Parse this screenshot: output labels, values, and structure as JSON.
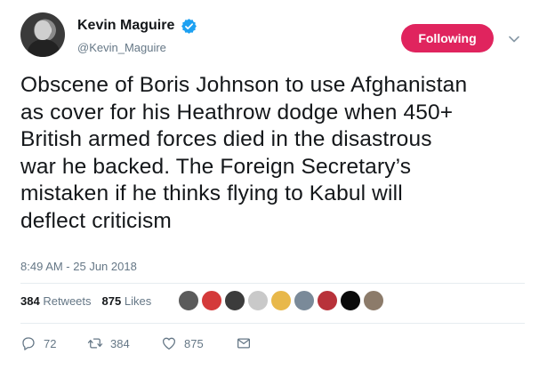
{
  "user": {
    "display_name": "Kevin Maguire",
    "handle": "@Kevin_Maguire",
    "verified_icon": "verified-badge-icon",
    "avatar_icon": "profile-avatar"
  },
  "follow_button": {
    "label": "Following",
    "color": "#e0245e"
  },
  "menu": {
    "icon": "chevron-down-icon"
  },
  "tweet": {
    "lines": [
      "Obscene of Boris Johnson to use Afghanistan",
      "as cover for his Heathrow dodge when 450+",
      "British armed forces died in the disastrous",
      "war he backed. The Foreign Secretary’s",
      "mistaken if he thinks flying to Kabul will",
      "deflect criticism"
    ],
    "timestamp": "8:49 AM - 25 Jun 2018"
  },
  "stats": {
    "retweets_count": "384",
    "retweets_label": "Retweets",
    "likes_count": "875",
    "likes_label": "Likes"
  },
  "likers": [
    {
      "name": "liker-avatar-1",
      "color": "#5b5b5b"
    },
    {
      "name": "liker-avatar-2",
      "color": "#d43a3a"
    },
    {
      "name": "liker-avatar-3",
      "color": "#3c3c3c"
    },
    {
      "name": "liker-avatar-4",
      "color": "#c9c9c9"
    },
    {
      "name": "liker-avatar-5",
      "color": "#e8b84a"
    },
    {
      "name": "liker-avatar-6",
      "color": "#7a8a99"
    },
    {
      "name": "liker-avatar-7",
      "color": "#b8323a"
    },
    {
      "name": "liker-avatar-8",
      "color": "#0a0a0a"
    },
    {
      "name": "liker-avatar-9",
      "color": "#8c7b6a"
    }
  ],
  "actions": {
    "reply_count": "72",
    "retweet_count": "384",
    "like_count": "875",
    "reply_icon": "reply-icon",
    "retweet_icon": "retweet-icon",
    "like_icon": "heart-icon",
    "dm_icon": "envelope-icon"
  },
  "colors": {
    "text": "#14171a",
    "secondary": "#657786",
    "verified": "#1da1f2",
    "divider": "#e6ecf0"
  }
}
